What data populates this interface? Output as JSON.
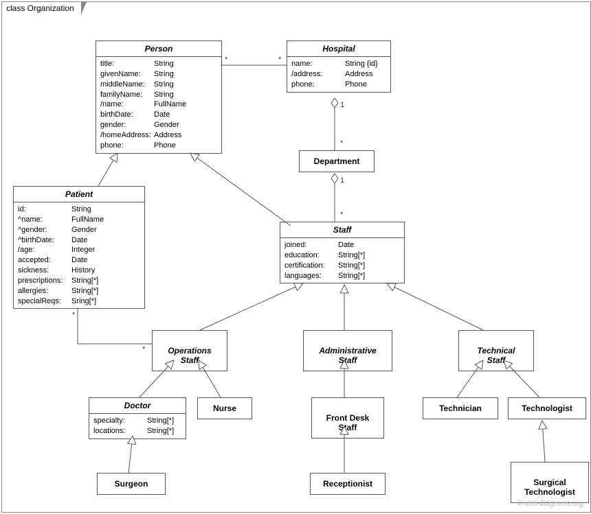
{
  "frame": "class Organization",
  "watermark": "© uml-diagrams.org",
  "classes": {
    "Person": {
      "name": "Person",
      "attrs": [
        [
          "title:",
          "String"
        ],
        [
          "givenName:",
          "String"
        ],
        [
          "middleName:",
          "String"
        ],
        [
          "familyName:",
          "String"
        ],
        [
          "/name:",
          "FullName"
        ],
        [
          "birthDate:",
          "Date"
        ],
        [
          "gender:",
          "Gender"
        ],
        [
          "/homeAddress:",
          "Address"
        ],
        [
          "phone:",
          "Phone"
        ]
      ]
    },
    "Hospital": {
      "name": "Hospital",
      "attrs": [
        [
          "name:",
          "String {id}"
        ],
        [
          "/address:",
          "Address"
        ],
        [
          "phone:",
          "Phone"
        ]
      ]
    },
    "Department": {
      "name": "Department"
    },
    "Patient": {
      "name": "Patient",
      "attrs": [
        [
          "id:",
          "String"
        ],
        [
          "^name:",
          "FullName"
        ],
        [
          "^gender:",
          "Gender"
        ],
        [
          "^birthDate:",
          "Date"
        ],
        [
          "/age:",
          "Integer"
        ],
        [
          "accepted:",
          "Date"
        ],
        [
          "sickness:",
          "History"
        ],
        [
          "prescriptions:",
          "String[*]"
        ],
        [
          "allergies:",
          "String[*]"
        ],
        [
          "specialReqs:",
          "Sring[*]"
        ]
      ]
    },
    "Staff": {
      "name": "Staff",
      "attrs": [
        [
          "joined:",
          "Date"
        ],
        [
          "education:",
          "String[*]"
        ],
        [
          "certification:",
          "String[*]"
        ],
        [
          "languages:",
          "String[*]"
        ]
      ]
    },
    "OperationsStaff": {
      "name": "Operations\nStaff"
    },
    "AdministrativeStaff": {
      "name": "Administrative\nStaff"
    },
    "TechnicalStaff": {
      "name": "Technical\nStaff"
    },
    "Doctor": {
      "name": "Doctor",
      "attrs": [
        [
          "specialty:",
          "String[*]"
        ],
        [
          "locations:",
          "String[*]"
        ]
      ]
    },
    "Nurse": {
      "name": "Nurse"
    },
    "FrontDeskStaff": {
      "name": "Front Desk\nStaff"
    },
    "Technician": {
      "name": "Technician"
    },
    "Technologist": {
      "name": "Technologist"
    },
    "Surgeon": {
      "name": "Surgeon"
    },
    "Receptionist": {
      "name": "Receptionist"
    },
    "SurgicalTechnologist": {
      "name": "Surgical\nTechnologist"
    }
  },
  "multiplicities": {
    "person_hospital_left": "*",
    "person_hospital_right": "*",
    "hospital_dept_top": "1",
    "hospital_dept_bottom": "*",
    "dept_staff_top": "1",
    "dept_staff_bottom": "*",
    "patient_ops_left": "*",
    "patient_ops_right": "*"
  }
}
